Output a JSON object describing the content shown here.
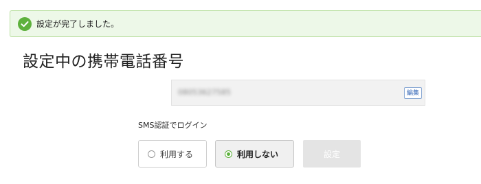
{
  "banner": {
    "message": "設定が完了しました。"
  },
  "page": {
    "title": "設定中の携帯電話番号"
  },
  "phone": {
    "value": "08053627585",
    "edit_label": "編集"
  },
  "sms_login": {
    "label": "SMS認証でログイン",
    "options": [
      {
        "label": "利用する",
        "selected": false
      },
      {
        "label": "利用しない",
        "selected": true
      }
    ],
    "submit_label": "設定"
  },
  "colors": {
    "success_green": "#5db13c",
    "banner_bg": "#edf8e8",
    "edit_blue": "#2f63b5"
  }
}
